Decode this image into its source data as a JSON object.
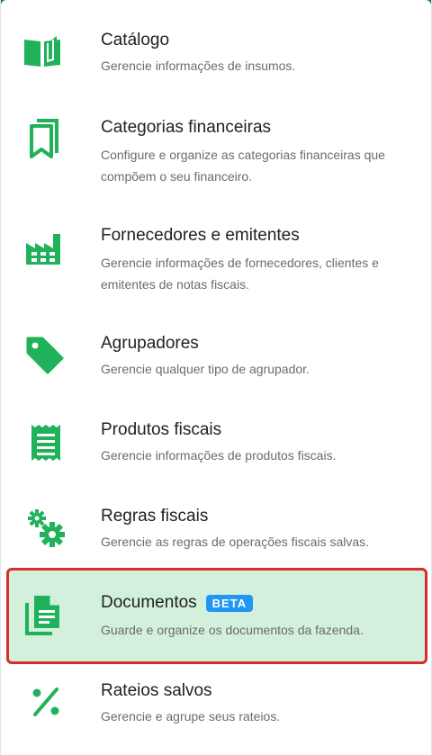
{
  "accent_color": "#1fb25a",
  "items": [
    {
      "title": "Catálogo",
      "description": "Gerencie informações de insumos.",
      "icon": "book-open-icon"
    },
    {
      "title": "Categorias financeiras",
      "description": "Configure e organize as categorias financeiras que compõem o seu financeiro.",
      "icon": "bookmarks-icon"
    },
    {
      "title": "Fornecedores e emitentes",
      "description": "Gerencie informações de fornecedores, clientes e emitentes de notas fiscais.",
      "icon": "factory-icon"
    },
    {
      "title": "Agrupadores",
      "description": "Gerencie qualquer tipo de agrupador.",
      "icon": "tag-icon"
    },
    {
      "title": "Produtos fiscais",
      "description": "Gerencie informações de produtos fiscais.",
      "icon": "receipt-icon"
    },
    {
      "title": "Regras fiscais",
      "description": "Gerencie as regras de operações fiscais salvas.",
      "icon": "gears-icon"
    },
    {
      "title": "Documentos",
      "badge": "BETA",
      "description": "Guarde e organize os documentos da fazenda.",
      "icon": "documents-icon",
      "selected": true
    },
    {
      "title": "Rateios salvos",
      "description": "Gerencie e agrupe seus rateios.",
      "icon": "percent-icon"
    }
  ]
}
